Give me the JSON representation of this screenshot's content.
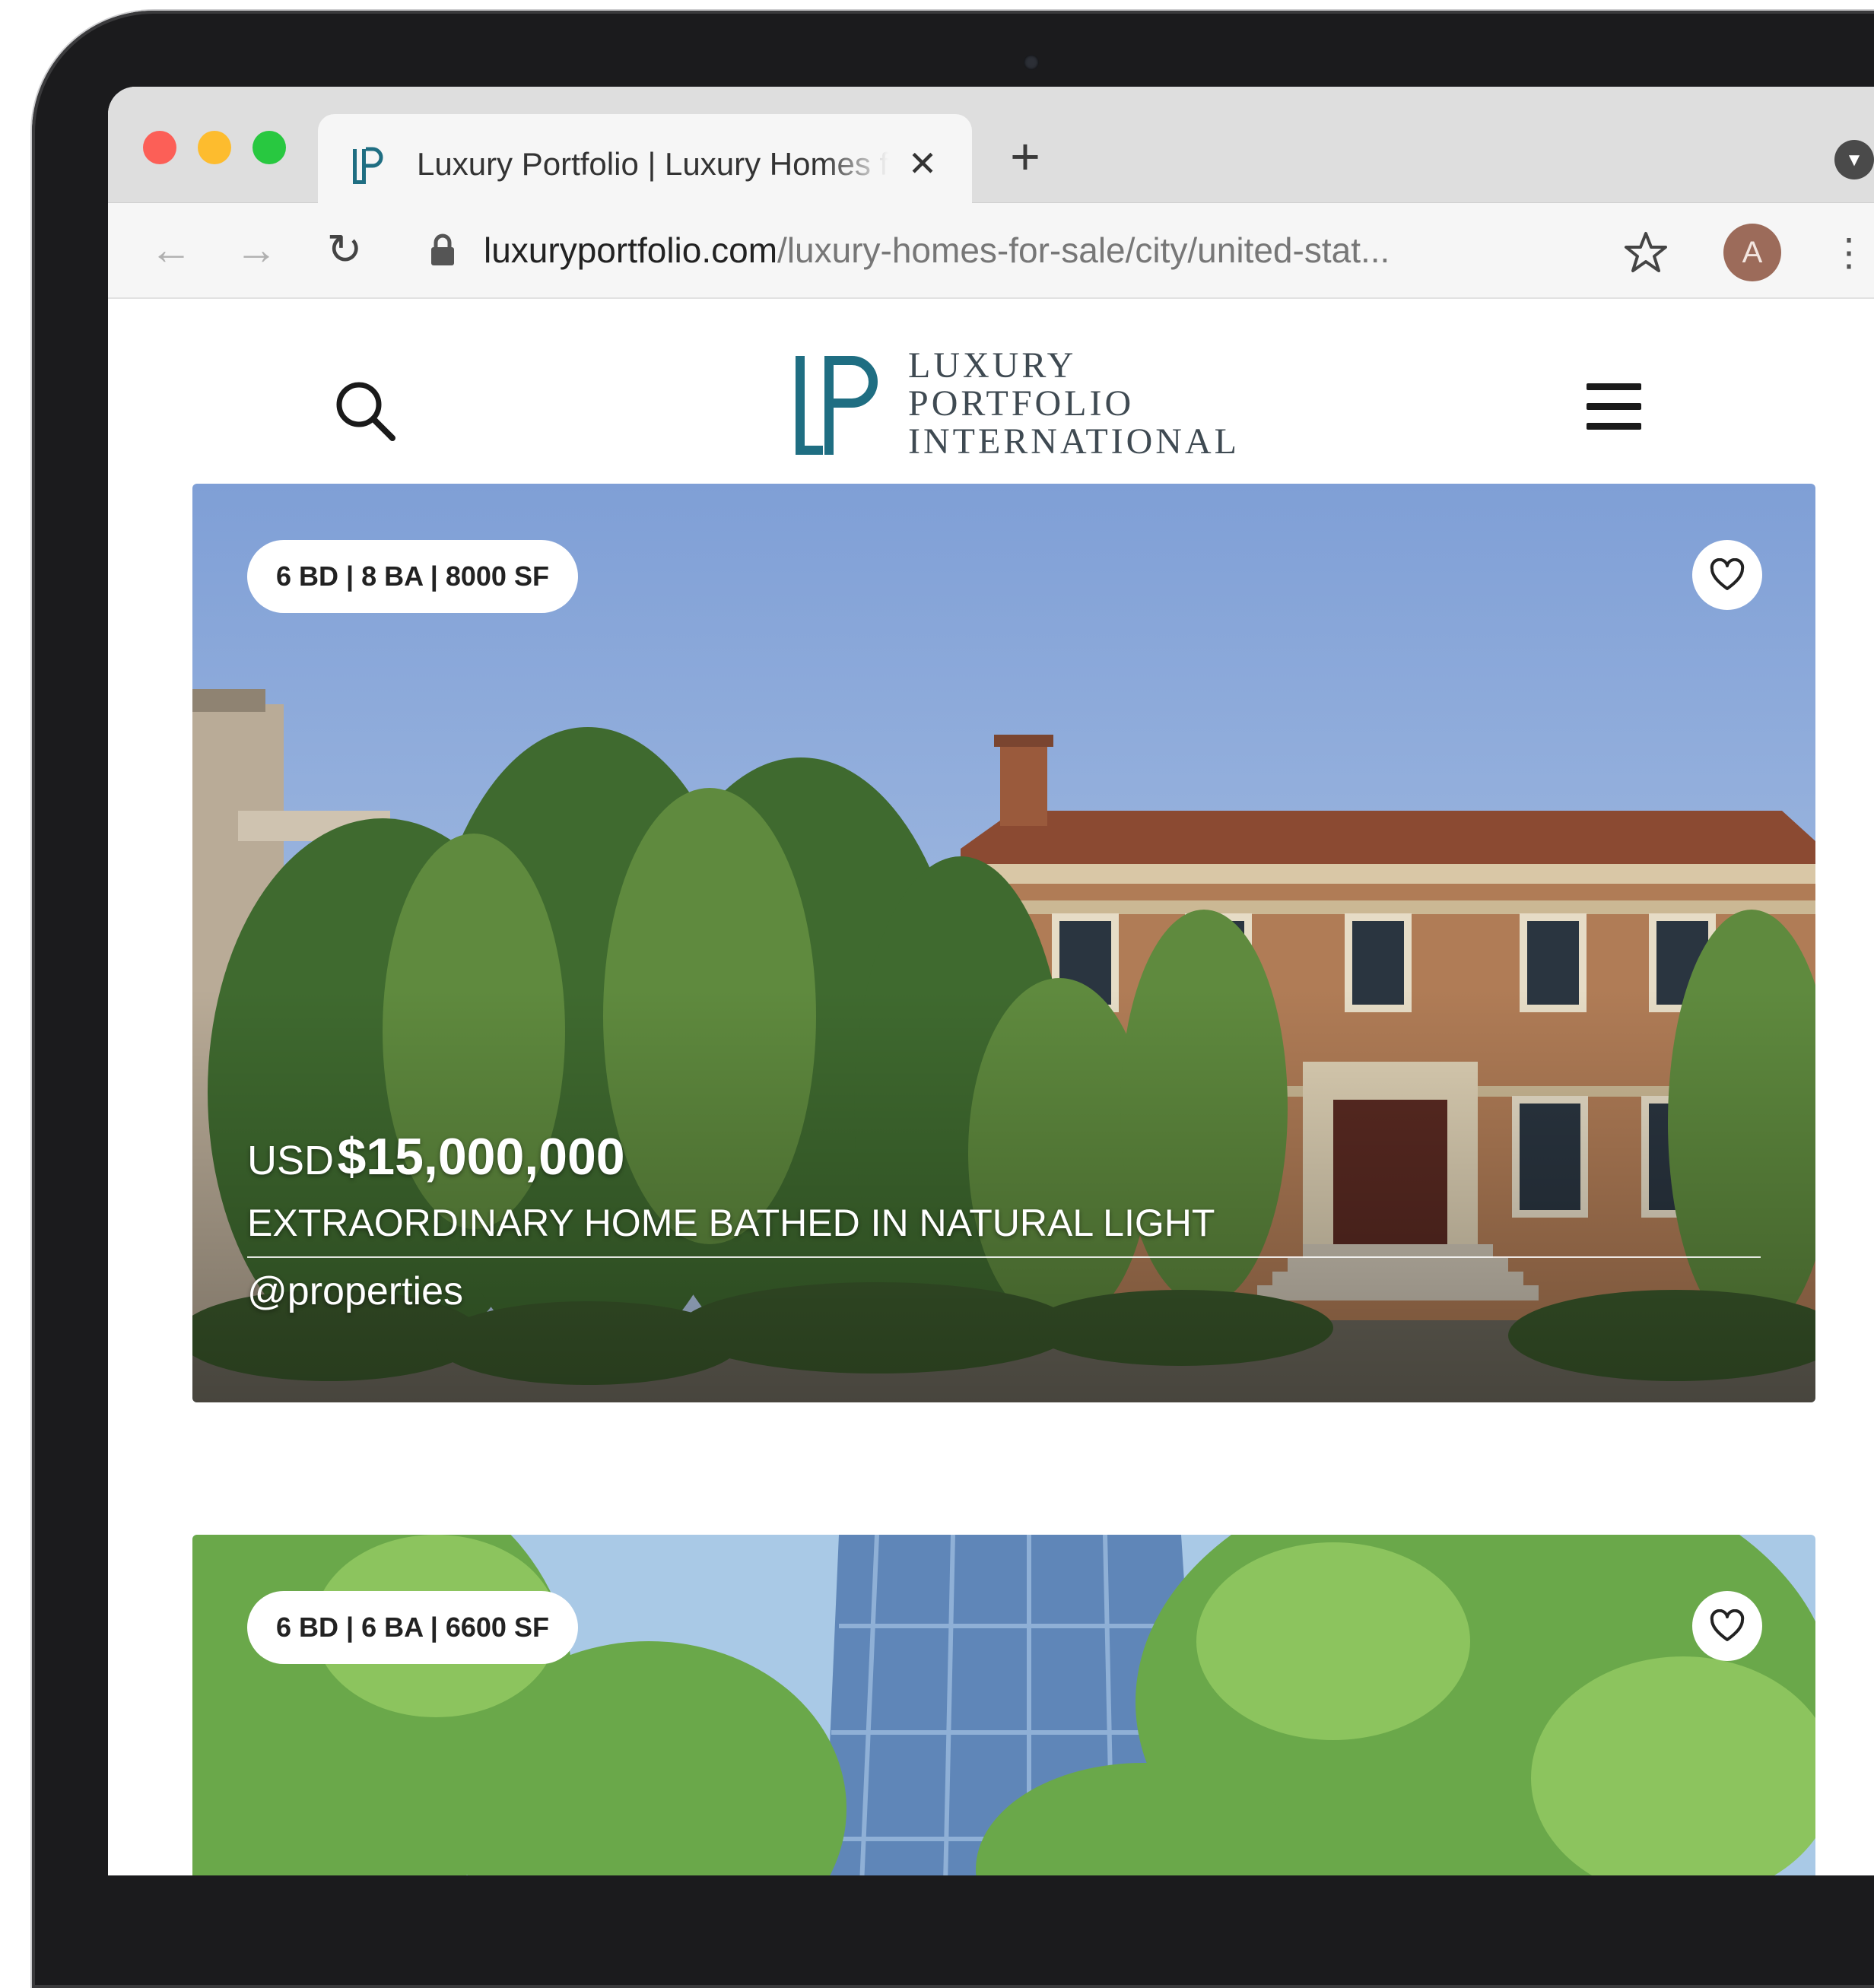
{
  "browser": {
    "tab": {
      "title": "Luxury Portfolio | Luxury Homes for Sale",
      "close_label": "✕"
    },
    "new_tab_label": "+",
    "url_host": "luxuryportfolio.com",
    "url_path": "/luxury-homes-for-sale/city/united-stat...",
    "profile_initial": "A",
    "traffic_light_colors": [
      "#fc5f57",
      "#fdbc2e",
      "#28c840"
    ]
  },
  "site": {
    "logo_lines": [
      "LUXURY",
      "PORTFOLIO",
      "INTERNATIONAL"
    ],
    "brand_color": "#1f6e82",
    "icons": [
      "search-icon",
      "hamburger-menu-icon",
      "heart-icon"
    ]
  },
  "listings": [
    {
      "specs": "6 BD | 8 BA | 8000 SF",
      "currency": "USD",
      "price": "$15,000,000",
      "title": "EXTRAORDINARY HOME BATHED IN NATURAL LIGHT",
      "agent": "@properties"
    },
    {
      "specs": "6 BD | 6 BA | 6600 SF"
    }
  ]
}
